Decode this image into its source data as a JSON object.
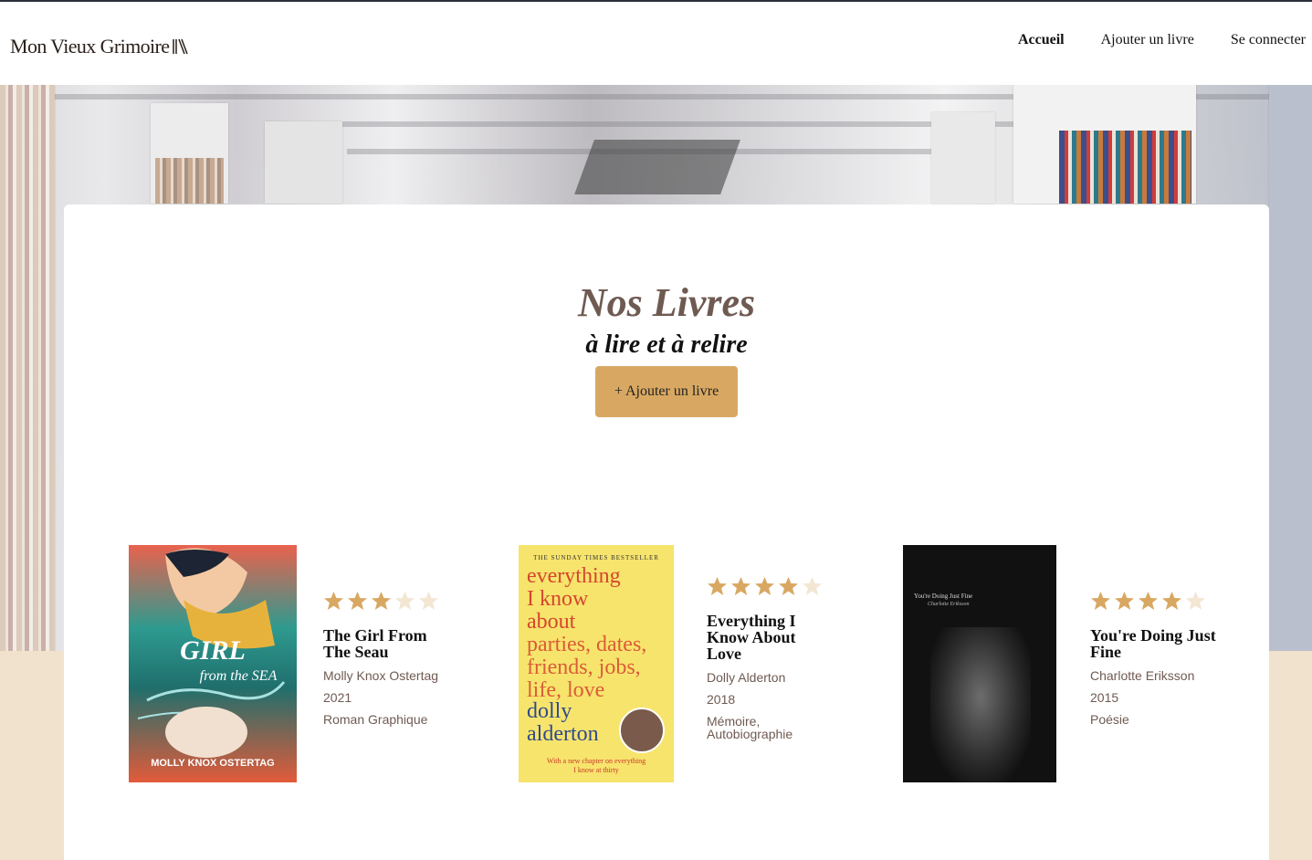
{
  "header": {
    "logo_text": "Mon Vieux Grimoire",
    "nav": [
      {
        "label": "Accueil",
        "active": true
      },
      {
        "label": "Ajouter un livre",
        "active": false
      },
      {
        "label": "Se connecter",
        "active": false
      }
    ]
  },
  "main": {
    "title": "Nos Livres",
    "subtitle": "à lire et à relire",
    "add_button": "+ Ajouter un livre"
  },
  "books": [
    {
      "title": "The Girl From The Seau",
      "author": "Molly Knox Ostertag",
      "year": "2021",
      "genre": "Roman Graphique",
      "rating": 3,
      "cover_text_main": "GIRL from the SEA",
      "cover_text_author": "MOLLY KNOX OSTERTAG"
    },
    {
      "title": "Everything I Know About Love",
      "author": "Dolly Alderton",
      "year": "2018",
      "genre": "Mémoire, Autobiographie",
      "rating": 4,
      "cover_top": "THE SUNDAY TIMES BESTSELLER",
      "cover_lines": [
        "everything",
        "I know",
        "about"
      ],
      "cover_author": [
        "dolly",
        "alderton"
      ],
      "cover_bottom": "With a new chapter on everything I know at thirty"
    },
    {
      "title": "You're Doing Just Fine",
      "author": "Charlotte Eriksson",
      "year": "2015",
      "genre": "Poésie",
      "rating": 4,
      "cover_title": "You're Doing Just Fine",
      "cover_author": "Charlotte Eriksson"
    }
  ],
  "colors": {
    "accent": "#d8a862",
    "title_brown": "#6f5a52",
    "star_filled": "#d8a862",
    "star_empty": "#f3e6d3",
    "cream": "#f0e2cd"
  }
}
